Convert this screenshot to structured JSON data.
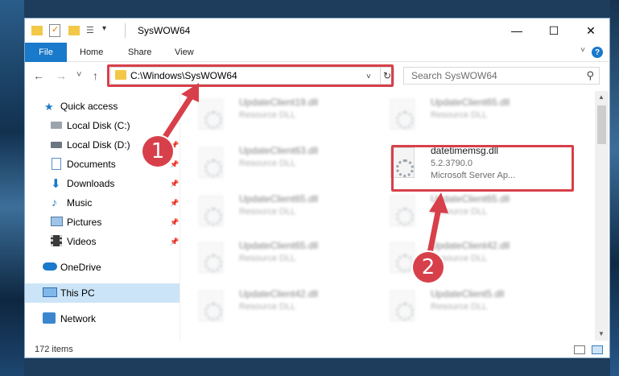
{
  "window": {
    "title": "SysWOW64",
    "minimize": "—",
    "maximize": "☐",
    "close": "✕"
  },
  "ribbon": {
    "tabs": [
      "File",
      "Home",
      "Share",
      "View"
    ],
    "help": "?"
  },
  "nav": {
    "back": "←",
    "forward": "→",
    "recent": "˅",
    "up": "↑",
    "address": "C:\\Windows\\SysWOW64",
    "search_placeholder": "Search SysWOW64"
  },
  "sidebar": {
    "items": [
      {
        "label": "Quick access",
        "icon": "star-icon",
        "pinned": false
      },
      {
        "label": "Local Disk (C:)",
        "icon": "drive-icon",
        "pinned": false
      },
      {
        "label": "Local Disk (D:)",
        "icon": "drive-icon",
        "pinned": true
      },
      {
        "label": "Documents",
        "icon": "documents-icon",
        "pinned": true
      },
      {
        "label": "Downloads",
        "icon": "download-icon",
        "pinned": true
      },
      {
        "label": "Music",
        "icon": "music-icon",
        "pinned": true
      },
      {
        "label": "Pictures",
        "icon": "pictures-icon",
        "pinned": true
      },
      {
        "label": "Videos",
        "icon": "videos-icon",
        "pinned": true
      },
      {
        "label": "OneDrive",
        "icon": "cloud-icon",
        "pinned": false
      },
      {
        "label": "This PC",
        "icon": "pc-icon",
        "pinned": false,
        "selected": true
      },
      {
        "label": "Network",
        "icon": "network-icon",
        "pinned": false
      }
    ]
  },
  "files": [
    {
      "name": "UpdateClient19.dll",
      "sub": "Resource DLL"
    },
    {
      "name": "UpdateClient65.dll",
      "sub": "Resource DLL"
    },
    {
      "name": "UpdateClient63.dll",
      "sub": "Resource DLL"
    },
    {
      "name": "datetimemsg.dll",
      "sub": "5.2.3790.0",
      "sub2": "Microsoft Server Ap...",
      "highlighted": true
    },
    {
      "name": "UpdateClient65.dll",
      "sub": "Resource DLL"
    },
    {
      "name": "UpdateClient65.dll",
      "sub": "Resource DLL"
    },
    {
      "name": "UpdateClient65.dll",
      "sub": "Resource DLL"
    },
    {
      "name": "UpdateClient42.dll",
      "sub": "Resource DLL"
    },
    {
      "name": "UpdateClient42.dll",
      "sub": "Resource DLL"
    },
    {
      "name": "UpdateClient5.dll",
      "sub": "Resource DLL"
    }
  ],
  "status": {
    "count": "172 items"
  },
  "annotations": {
    "step1": "1",
    "step2": "2",
    "accent": "#d7404a"
  }
}
